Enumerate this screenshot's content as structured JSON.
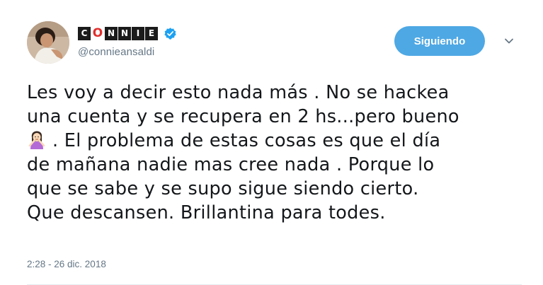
{
  "author": {
    "display_name_letters": [
      "C",
      "O",
      "N",
      "N",
      "I",
      "E"
    ],
    "handle": "@connieansaldi",
    "verified": true,
    "avatar_icon": "profile-photo",
    "verified_icon": "verified-badge-icon",
    "accent_color": "#e0302d"
  },
  "actions": {
    "follow_label": "Siguiendo",
    "follow_color": "#4ea8e4",
    "more_icon": "chevron-down-icon"
  },
  "tweet": {
    "lines": [
      "Les voy a decir esto nada más . No se hackea",
      "una cuenta y se recupera en 2 hs...pero bueno",
      ". El problema de estas cosas es que el día",
      "de mañana nadie mas cree nada . Porque lo",
      "que se sabe y se supo sigue siendo cierto.",
      "Que descansen. Brillantina para todes."
    ],
    "emoji_icon": "woman-gesturing-ok-emoji",
    "timestamp": "2:28 - 26 dic. 2018"
  }
}
